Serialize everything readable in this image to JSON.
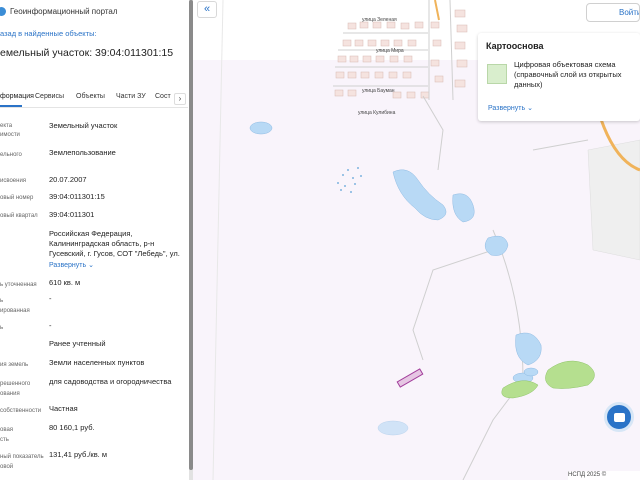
{
  "header": {
    "portal_title": "Геоинформационный портал",
    "back_link": "азад в найденные объекты:",
    "parcel_title": "емельный участок: 39:04:011301:15"
  },
  "tabs": [
    {
      "label": "формация",
      "active": true
    },
    {
      "label": "Сервисы",
      "active": false
    },
    {
      "label": "Объекты",
      "active": false
    },
    {
      "label": "Части ЗУ",
      "active": false
    },
    {
      "label": "Сост",
      "active": false
    }
  ],
  "tab_next": "›",
  "props": [
    {
      "label": "екта",
      "label2": "имости",
      "value": "Земельный участок"
    },
    {
      "label": "ельного",
      "label2": "",
      "value": "Землепользование"
    },
    {
      "label": "исвоения",
      "label2": "",
      "value": "20.07.2007"
    },
    {
      "label": "овый номер",
      "label2": "",
      "value": "39:04:011301:15"
    },
    {
      "label": "овый квартал",
      "label2": "",
      "value": "39:04:011301"
    },
    {
      "label": "",
      "label2": "",
      "value": "Российская Федерация, Калининградская область, р-н Гусевский, г. Гусов, СОТ \"Лебедь\", ул.",
      "expand": "Развернуть"
    },
    {
      "label": "ь уточненная",
      "label2": "",
      "value": "610 кв. м"
    },
    {
      "label": "ь",
      "label2": "ированная",
      "value": "-"
    },
    {
      "label": "ь",
      "label2": "",
      "value": "-"
    },
    {
      "label": "",
      "label2": "",
      "value": "Ранее учтенный"
    },
    {
      "label": "ия земель",
      "label2": "",
      "value": "Земли населенных пунктов"
    },
    {
      "label": "решенного",
      "label2": "ования",
      "value": "для садоводства и огородничества"
    },
    {
      "label": "собственности",
      "label2": "",
      "value": "Частная"
    },
    {
      "label": "овая",
      "label2": "сть",
      "value": "80 160,1 руб."
    },
    {
      "label": "ный показатель",
      "label2": "овой",
      "value": "131,41 руб./кв. м"
    }
  ],
  "map": {
    "collapse_icon": "«",
    "login_label": "Войти",
    "basemap_title": "Картооснова",
    "basemap_desc": "Цифровая объектовая схема (справочный слой из открытых данных)",
    "basemap_expand": "Развернуть",
    "attribution": "НСПД 2025 ©",
    "street_labels": [
      "улица Зеленая",
      "улица Мира",
      "улица Кулибина",
      "улица Бауман"
    ]
  },
  "colors": {
    "accent": "#2a73c7",
    "water": "#b8d9f5",
    "park": "#b5df8f",
    "selection": "#a23d9b"
  }
}
